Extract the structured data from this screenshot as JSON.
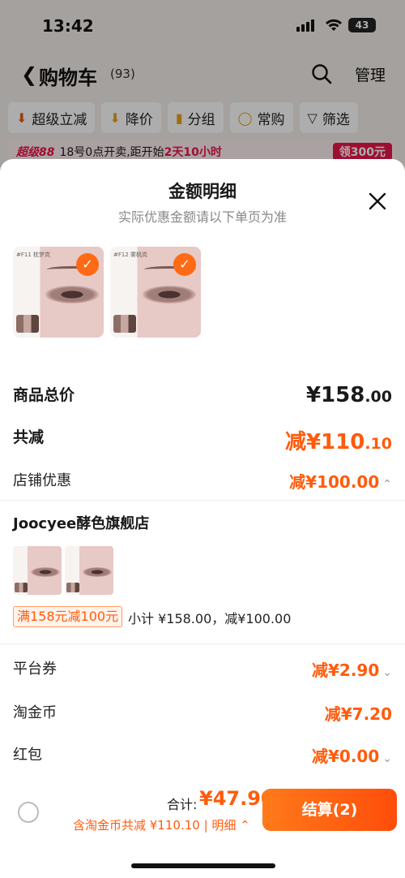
{
  "status_bar": {
    "time": "13:42",
    "battery": "43"
  },
  "nav": {
    "title": "购物车",
    "count": "(93)",
    "manage": "管理"
  },
  "chips": [
    {
      "icon": "down-arrow-icon",
      "label": "超级立减"
    },
    {
      "icon": "price-down-icon",
      "label": "降价"
    },
    {
      "icon": "folder-icon",
      "label": "分组"
    },
    {
      "icon": "cart-icon",
      "label": "常购"
    },
    {
      "icon": "filter-icon",
      "label": "筛选"
    }
  ],
  "promo": {
    "tag": "超级88",
    "text": "18号0点开卖,距开始",
    "countdown": "2天10小时",
    "button": "领300元"
  },
  "sheet": {
    "title": "金额明细",
    "subtitle": "实际优惠金额请以下单页为准",
    "products": [
      {
        "label": "#F11\n枕梦岚"
      },
      {
        "label": "#F12\n雾桃岚"
      }
    ],
    "total_price": {
      "label": "商品总价",
      "value": "¥158",
      "decimal": ".00"
    },
    "total_discount": {
      "label": "共减",
      "value": "减¥110",
      "decimal": ".10"
    },
    "store_discount": {
      "label": "店铺优惠",
      "value": "减¥100.00"
    },
    "store": {
      "name": "Joocyee酵色旗舰店",
      "coupon": "满158元减100元",
      "subtotal": "小计 ¥158.00，减¥100.00"
    },
    "platform_coupon": {
      "label": "平台券",
      "value": "减¥2.90"
    },
    "taojinbi": {
      "label": "淘金币",
      "value": "减¥7.20"
    },
    "red_packet": {
      "label": "红包",
      "value": "减¥0.00"
    }
  },
  "footer": {
    "total_label": "合计:",
    "total_value": "¥47.90",
    "note": "含淘金币共减 ¥110.10 | 明细",
    "checkout": "结算(2)"
  },
  "colors": {
    "accent": "#ff5b0c",
    "promo_red": "#e8174a"
  }
}
